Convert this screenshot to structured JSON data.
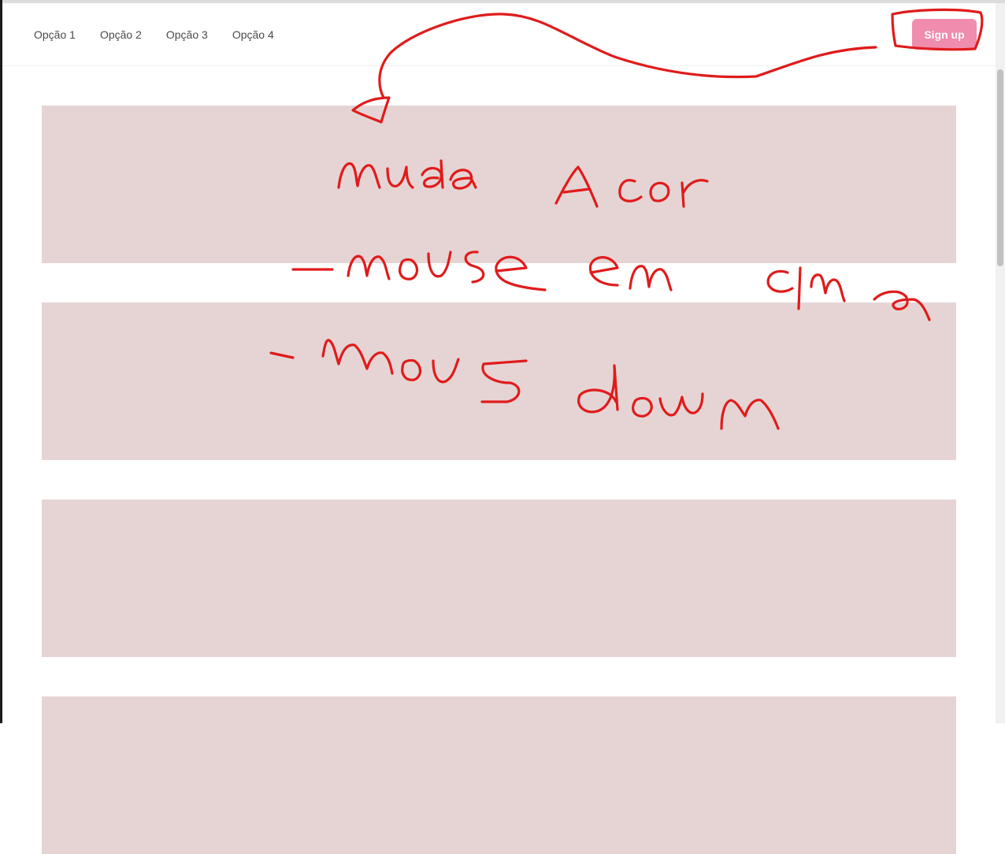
{
  "navbar": {
    "links": [
      "Opção 1",
      "Opção 2",
      "Opção 3",
      "Opção 4"
    ],
    "signup_label": "Sign up"
  },
  "annotation": {
    "lines": [
      "muda a cor",
      "-mouse em cima",
      "-mous down"
    ]
  },
  "colors": {
    "signup_bg": "#f08cad",
    "block_bg": "#e6d4d4",
    "annotation_ink": "#e01b1b"
  }
}
